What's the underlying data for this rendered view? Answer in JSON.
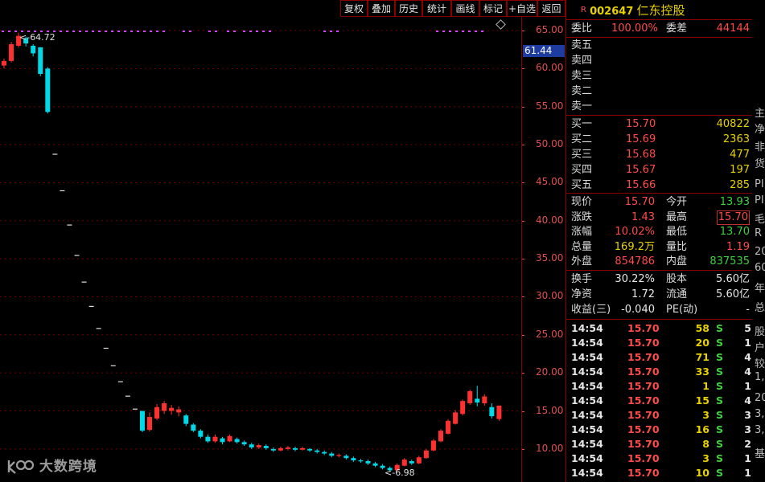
{
  "toolbar": {
    "buttons": [
      "复权",
      "叠加",
      "历史",
      "统计",
      "画线",
      "标记",
      "+自选",
      "返回"
    ]
  },
  "chart": {
    "y_ticks": [
      "65.00",
      "60.00",
      "55.00",
      "50.00",
      "45.00",
      "40.00",
      "35.00",
      "30.00",
      "25.00",
      "20.00",
      "15.00",
      "10.00"
    ],
    "current_price_tag": "61.44",
    "max_label": "64.72",
    "min_label": "6.98",
    "colors": {
      "up": "#ff3030",
      "down": "#00d8e8",
      "grid": "#6a0000",
      "marker": "#d040ff"
    }
  },
  "chart_data": {
    "type": "candlestick",
    "ylim": [
      7,
      66
    ],
    "candles": [
      {
        "o": 60.4,
        "c": 61.0,
        "h": 61.3,
        "l": 60.0
      },
      {
        "o": 61.0,
        "c": 63.2,
        "h": 63.5,
        "l": 60.8
      },
      {
        "o": 63.0,
        "c": 64.3,
        "h": 64.72,
        "l": 62.8
      },
      {
        "o": 64.0,
        "c": 63.3,
        "h": 64.2,
        "l": 62.9
      },
      {
        "o": 63.0,
        "c": 62.0,
        "h": 63.2,
        "l": 61.6
      },
      {
        "o": 62.8,
        "c": 59.3,
        "h": 62.8,
        "l": 59.0
      },
      {
        "o": 60.0,
        "c": 54.3,
        "h": 60.2,
        "l": 54.1
      },
      {
        "o": 48.8,
        "c": 48.8,
        "h": 48.8,
        "l": 48.8
      },
      {
        "o": 44.0,
        "c": 44.0,
        "h": 44.0,
        "l": 44.0
      },
      {
        "o": 39.5,
        "c": 39.5,
        "h": 39.5,
        "l": 39.5
      },
      {
        "o": 35.5,
        "c": 35.5,
        "h": 35.5,
        "l": 35.5
      },
      {
        "o": 32.0,
        "c": 32.0,
        "h": 32.0,
        "l": 32.0
      },
      {
        "o": 28.8,
        "c": 28.8,
        "h": 28.8,
        "l": 28.8
      },
      {
        "o": 25.9,
        "c": 25.9,
        "h": 25.9,
        "l": 25.9
      },
      {
        "o": 23.3,
        "c": 23.3,
        "h": 23.3,
        "l": 23.3
      },
      {
        "o": 21.0,
        "c": 21.0,
        "h": 21.0,
        "l": 21.0
      },
      {
        "o": 18.9,
        "c": 18.9,
        "h": 18.9,
        "l": 18.9
      },
      {
        "o": 17.0,
        "c": 17.0,
        "h": 17.0,
        "l": 17.0
      },
      {
        "o": 15.3,
        "c": 15.3,
        "h": 15.3,
        "l": 15.3
      },
      {
        "o": 15.0,
        "c": 12.4,
        "h": 15.0,
        "l": 12.2
      },
      {
        "o": 12.5,
        "c": 14.2,
        "h": 14.8,
        "l": 12.3
      },
      {
        "o": 14.0,
        "c": 15.5,
        "h": 15.9,
        "l": 13.8
      },
      {
        "o": 15.0,
        "c": 16.0,
        "h": 16.3,
        "l": 14.6
      },
      {
        "o": 15.0,
        "c": 15.4,
        "h": 15.8,
        "l": 14.5
      },
      {
        "o": 14.8,
        "c": 15.2,
        "h": 15.6,
        "l": 14.3
      },
      {
        "o": 14.4,
        "c": 13.3,
        "h": 14.6,
        "l": 13.0
      },
      {
        "o": 13.2,
        "c": 12.4,
        "h": 13.4,
        "l": 12.2
      },
      {
        "o": 12.4,
        "c": 11.6,
        "h": 12.6,
        "l": 11.4
      },
      {
        "o": 11.6,
        "c": 11.0,
        "h": 11.9,
        "l": 10.8
      },
      {
        "o": 11.0,
        "c": 11.6,
        "h": 11.9,
        "l": 10.8
      },
      {
        "o": 11.4,
        "c": 10.9,
        "h": 11.6,
        "l": 10.6
      },
      {
        "o": 11.0,
        "c": 11.7,
        "h": 11.9,
        "l": 10.9
      },
      {
        "o": 11.3,
        "c": 10.9,
        "h": 11.5,
        "l": 10.7
      },
      {
        "o": 10.9,
        "c": 10.6,
        "h": 11.1,
        "l": 10.4
      },
      {
        "o": 10.6,
        "c": 10.2,
        "h": 10.8,
        "l": 10.0
      },
      {
        "o": 10.2,
        "c": 10.5,
        "h": 10.7,
        "l": 10.0
      },
      {
        "o": 10.4,
        "c": 10.1,
        "h": 10.6,
        "l": 9.9
      },
      {
        "o": 10.0,
        "c": 9.8,
        "h": 10.2,
        "l": 9.6
      },
      {
        "o": 9.8,
        "c": 10.1,
        "h": 10.3,
        "l": 9.7
      },
      {
        "o": 10.0,
        "c": 10.2,
        "h": 10.4,
        "l": 9.8
      },
      {
        "o": 10.1,
        "c": 9.9,
        "h": 10.3,
        "l": 9.7
      },
      {
        "o": 9.9,
        "c": 10.1,
        "h": 10.3,
        "l": 9.8
      },
      {
        "o": 10.0,
        "c": 9.8,
        "h": 10.1,
        "l": 9.6
      },
      {
        "o": 9.8,
        "c": 9.6,
        "h": 10.0,
        "l": 9.4
      },
      {
        "o": 9.6,
        "c": 9.4,
        "h": 9.8,
        "l": 9.2
      },
      {
        "o": 9.4,
        "c": 9.1,
        "h": 9.6,
        "l": 8.9
      },
      {
        "o": 9.1,
        "c": 9.2,
        "h": 9.4,
        "l": 8.9
      },
      {
        "o": 9.1,
        "c": 8.8,
        "h": 9.3,
        "l": 8.6
      },
      {
        "o": 8.8,
        "c": 8.5,
        "h": 9.0,
        "l": 8.3
      },
      {
        "o": 8.5,
        "c": 8.4,
        "h": 8.7,
        "l": 8.2
      },
      {
        "o": 8.4,
        "c": 8.1,
        "h": 8.6,
        "l": 7.9
      },
      {
        "o": 8.1,
        "c": 7.8,
        "h": 8.3,
        "l": 7.6
      },
      {
        "o": 7.8,
        "c": 7.5,
        "h": 8.0,
        "l": 7.3
      },
      {
        "o": 7.5,
        "c": 7.2,
        "h": 7.7,
        "l": 6.98
      },
      {
        "o": 7.2,
        "c": 7.9,
        "h": 8.1,
        "l": 7.1
      },
      {
        "o": 7.8,
        "c": 8.6,
        "h": 8.8,
        "l": 7.7
      },
      {
        "o": 8.4,
        "c": 8.1,
        "h": 8.6,
        "l": 7.9
      },
      {
        "o": 8.1,
        "c": 8.9,
        "h": 9.1,
        "l": 8.0
      },
      {
        "o": 8.8,
        "c": 9.8,
        "h": 10.0,
        "l": 8.7
      },
      {
        "o": 9.8,
        "c": 11.1,
        "h": 11.3,
        "l": 9.7
      },
      {
        "o": 11.0,
        "c": 12.4,
        "h": 12.6,
        "l": 10.9
      },
      {
        "o": 12.0,
        "c": 13.7,
        "h": 13.9,
        "l": 11.9
      },
      {
        "o": 13.3,
        "c": 14.8,
        "h": 15.1,
        "l": 13.2
      },
      {
        "o": 14.6,
        "c": 16.3,
        "h": 16.5,
        "l": 14.4
      },
      {
        "o": 16.0,
        "c": 17.6,
        "h": 17.8,
        "l": 15.8
      },
      {
        "o": 16.6,
        "c": 16.1,
        "h": 18.3,
        "l": 15.6
      },
      {
        "o": 16.0,
        "c": 16.9,
        "h": 17.2,
        "l": 15.7
      },
      {
        "o": 15.5,
        "c": 14.3,
        "h": 16.0,
        "l": 14.0
      },
      {
        "o": 13.93,
        "c": 15.7,
        "h": 15.7,
        "l": 13.7
      }
    ]
  },
  "panel": {
    "header": {
      "badge": "R",
      "code": "002647",
      "name": "仁东控股"
    },
    "weibi": {
      "label": "委比",
      "value": "100.00%",
      "label2": "委差",
      "value2": "44144"
    },
    "sells": [
      {
        "label": "卖五"
      },
      {
        "label": "卖四"
      },
      {
        "label": "卖三"
      },
      {
        "label": "卖二"
      },
      {
        "label": "卖一"
      }
    ],
    "buys": [
      {
        "label": "买一",
        "price": "15.70",
        "vol": "40822"
      },
      {
        "label": "买二",
        "price": "15.69",
        "vol": "2363"
      },
      {
        "label": "买三",
        "price": "15.68",
        "vol": "477"
      },
      {
        "label": "买四",
        "price": "15.67",
        "vol": "197"
      },
      {
        "label": "买五",
        "price": "15.66",
        "vol": "285"
      }
    ],
    "quote": [
      {
        "l1": "现价",
        "v1": "15.70",
        "l2": "今开",
        "v2": "13.93"
      },
      {
        "l1": "涨跌",
        "v1": "1.43",
        "l2": "最高",
        "v2": "15.70"
      },
      {
        "l1": "涨幅",
        "v1": "10.02%",
        "l2": "最低",
        "v2": "13.70"
      },
      {
        "l1": "总量",
        "v1": "169.2万",
        "l2": "量比",
        "v2": "1.19"
      },
      {
        "l1": "外盘",
        "v1": "854786",
        "l2": "内盘",
        "v2": "837535"
      }
    ],
    "stats": [
      {
        "l1": "换手",
        "v1": "30.22%",
        "l2": "股本",
        "v2": "5.60亿"
      },
      {
        "l1": "净资",
        "v1": "1.72",
        "l2": "流通",
        "v2": "5.60亿"
      },
      {
        "l1": "收益(三)",
        "v1": "-0.040",
        "l2": "PE(动)",
        "v2": "-"
      }
    ],
    "ticks": [
      {
        "t": "14:54",
        "p": "15.70",
        "v": "58",
        "s": "S",
        "n": "5"
      },
      {
        "t": "14:54",
        "p": "15.70",
        "v": "20",
        "s": "S",
        "n": "1"
      },
      {
        "t": "14:54",
        "p": "15.70",
        "v": "71",
        "s": "S",
        "n": "4"
      },
      {
        "t": "14:54",
        "p": "15.70",
        "v": "33",
        "s": "S",
        "n": "4"
      },
      {
        "t": "14:54",
        "p": "15.70",
        "v": "1",
        "s": "S",
        "n": "1"
      },
      {
        "t": "14:54",
        "p": "15.70",
        "v": "15",
        "s": "S",
        "n": "4"
      },
      {
        "t": "14:54",
        "p": "15.70",
        "v": "3",
        "s": "S",
        "n": "3"
      },
      {
        "t": "14:54",
        "p": "15.70",
        "v": "16",
        "s": "S",
        "n": "3"
      },
      {
        "t": "14:54",
        "p": "15.70",
        "v": "8",
        "s": "S",
        "n": "2"
      },
      {
        "t": "14:54",
        "p": "15.70",
        "v": "3",
        "s": "S",
        "n": "1"
      },
      {
        "t": "14:54",
        "p": "15.70",
        "v": "10",
        "s": "S",
        "n": "1"
      }
    ]
  },
  "right_strip": [
    "主",
    "净",
    "非",
    "货",
    "PI",
    "PI",
    "毛",
    "R",
    "20",
    "60",
    "年",
    "总",
    "股",
    "户",
    "较",
    "1,",
    "20",
    "3,",
    "3,",
    "基"
  ],
  "watermark": "大数跨境"
}
